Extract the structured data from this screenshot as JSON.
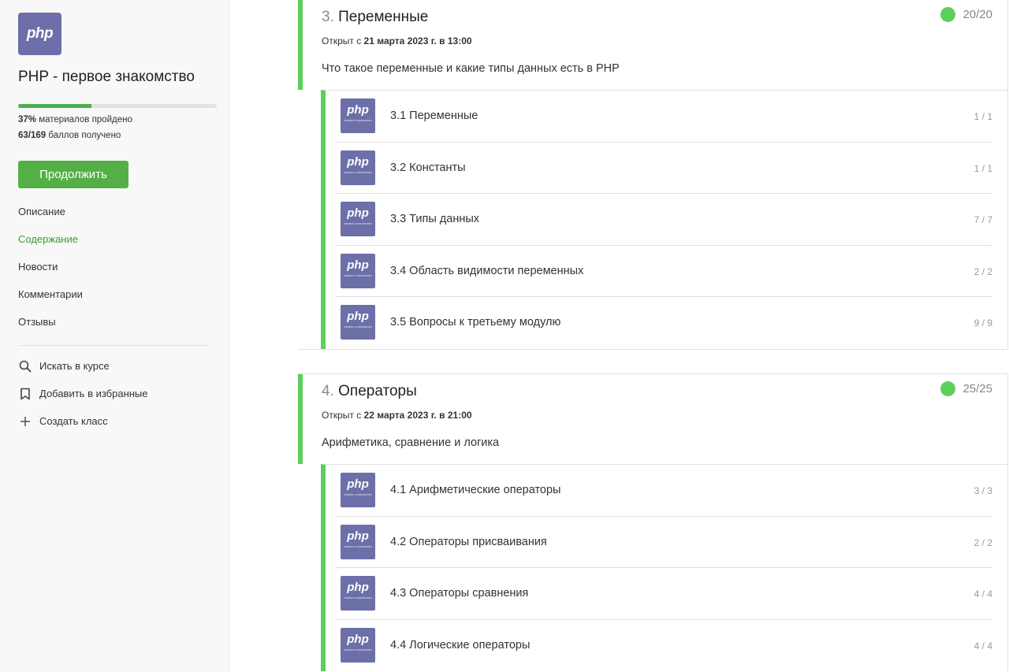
{
  "course": {
    "logo_text": "php",
    "title": "PHP - первое знакомство",
    "progress_fraction": 0.37,
    "materials_value": "37%",
    "materials_label": " материалов пройдено",
    "points_value": "63/169",
    "points_label": " баллов получено",
    "continue_label": "Продолжить"
  },
  "nav": {
    "items": [
      {
        "label": "Описание",
        "active": false
      },
      {
        "label": "Содержание",
        "active": true
      },
      {
        "label": "Новости",
        "active": false
      },
      {
        "label": "Комментарии",
        "active": false
      },
      {
        "label": "Отзывы",
        "active": false
      }
    ]
  },
  "actions": [
    {
      "icon": "search-icon",
      "label": "Искать в курсе"
    },
    {
      "icon": "bookmark-icon",
      "label": "Добавить в избранные"
    },
    {
      "icon": "plus-icon",
      "label": "Создать класс"
    }
  ],
  "colors": {
    "accent_green": "#54b046",
    "module_border": "#5ccf5c",
    "logo_purple": "#6c6fa8"
  },
  "thumb": {
    "php": "php",
    "subtitle": "первое знакомство"
  },
  "modules": [
    {
      "number": "3.",
      "title": "Переменные",
      "open_prefix": "Открыт с ",
      "open_date": "21 марта 2023 г. в 13:00",
      "description": "Что такое переменные и какие типы данных есть в PHP",
      "score": "20/20",
      "lessons": [
        {
          "title": "3.1 Переменные",
          "score": "1 / 1"
        },
        {
          "title": "3.2 Константы",
          "score": "1 / 1"
        },
        {
          "title": "3.3 Типы данных",
          "score": "7 / 7"
        },
        {
          "title": "3.4 Область видимости переменных",
          "score": "2 / 2"
        },
        {
          "title": "3.5 Вопросы к третьему модулю",
          "score": "9 / 9"
        }
      ]
    },
    {
      "number": "4.",
      "title": "Операторы",
      "open_prefix": "Открыт с ",
      "open_date": "22 марта 2023 г. в 21:00",
      "description": "Арифметика, сравнение и логика",
      "score": "25/25",
      "lessons": [
        {
          "title": "4.1 Арифметические операторы",
          "score": "3 / 3"
        },
        {
          "title": "4.2 Операторы присваивания",
          "score": "2 / 2"
        },
        {
          "title": "4.3 Операторы сравнения",
          "score": "4 / 4"
        },
        {
          "title": "4.4 Логические операторы",
          "score": "4 / 4"
        }
      ]
    }
  ]
}
